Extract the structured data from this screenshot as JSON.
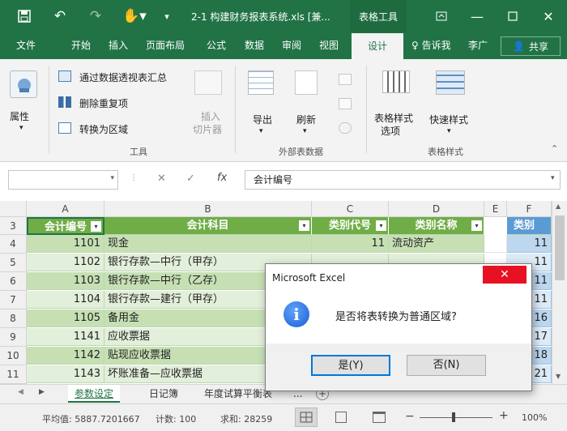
{
  "title_bar": {
    "title": "2-1 构建财务报表系统.xls [兼...",
    "context_tab": "表格工具"
  },
  "ribbon_tabs": {
    "file": "文件",
    "home": "开始",
    "insert": "插入",
    "page_layout": "页面布局",
    "formulas": "公式",
    "data": "数据",
    "review": "审阅",
    "view": "视图",
    "design": "设计",
    "tell_me": "告诉我",
    "user": "李广",
    "share": "共享"
  },
  "ribbon": {
    "properties": "属性",
    "summarize_pivot": "通过数据透视表汇总",
    "remove_duplicates": "删除重复项",
    "convert_range": "转换为区域",
    "insert_slicer_1": "插入",
    "insert_slicer_2": "切片器",
    "tools_group": "工具",
    "export": "导出",
    "refresh": "刷新",
    "external_group": "外部表数据",
    "style_options_1": "表格样式",
    "style_options_2": "选项",
    "quick_styles": "快速样式",
    "styles_group": "表格样式"
  },
  "formula_bar": {
    "name_box": "",
    "formula": "会计编号"
  },
  "columns": [
    "A",
    "B",
    "C",
    "D",
    "E",
    "F"
  ],
  "table_headers": [
    "会计编号",
    "会计科目",
    "类别代号",
    "类别名称",
    "类别"
  ],
  "rows": [
    {
      "n": "3"
    },
    {
      "n": "4",
      "code": "1101",
      "subject": "现金",
      "cat_code": "11",
      "cat_name": "流动资产",
      "f": "11"
    },
    {
      "n": "5",
      "code": "1102",
      "subject": "银行存款—中行（甲存）",
      "cat_code": "",
      "cat_name": "",
      "f": "11"
    },
    {
      "n": "6",
      "code": "1103",
      "subject": "银行存款—中行（乙存）",
      "cat_code": "",
      "cat_name": "",
      "f": "11"
    },
    {
      "n": "7",
      "code": "1104",
      "subject": "银行存款—建行（甲存）",
      "cat_code": "",
      "cat_name": "",
      "f": "11"
    },
    {
      "n": "8",
      "code": "1105",
      "subject": "备用金",
      "cat_code": "",
      "cat_name": "",
      "f": "16"
    },
    {
      "n": "9",
      "code": "1141",
      "subject": "应收票据",
      "cat_code": "",
      "cat_name": "",
      "f": "17"
    },
    {
      "n": "10",
      "code": "1142",
      "subject": "贴现应收票据",
      "cat_code": "",
      "cat_name": "",
      "f": "18"
    },
    {
      "n": "11",
      "code": "1143",
      "subject": "坏账准备—应收票据",
      "cat_code": "",
      "cat_name": "",
      "f": "21"
    }
  ],
  "sheets": {
    "active": "参数设定",
    "s2": "日记簿",
    "s3": "年度试算平衡表",
    "more": "..."
  },
  "status": {
    "average": "平均值: 5887.7201667",
    "count": "计数: 100",
    "sum": "求和: 28259",
    "zoom": "100%"
  },
  "dialog": {
    "title": "Microsoft Excel",
    "message": "是否将表转换为普通区域?",
    "yes": "是(Y)",
    "no": "否(N)"
  }
}
